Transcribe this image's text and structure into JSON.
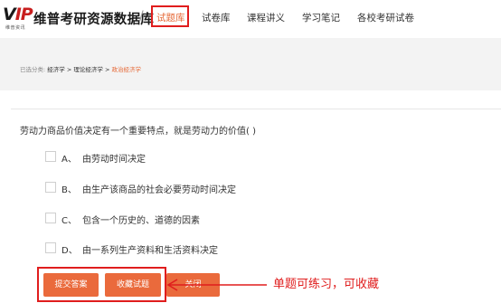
{
  "logo": {
    "mark_v": "V",
    "mark_ip": "IP",
    "subtitle": "维普资讯"
  },
  "brand": "维普考研资源数据库",
  "nav_separator": "/",
  "nav": [
    {
      "label": "试题库",
      "active": true
    },
    {
      "label": "试卷库"
    },
    {
      "label": "课程讲义"
    },
    {
      "label": "学习笔记"
    },
    {
      "label": "各校考研试卷"
    }
  ],
  "breadcrumb": {
    "prefix": "已选分类:",
    "path": [
      "经济学",
      "理论经济学"
    ],
    "current": "政治经济学",
    "separator": ">"
  },
  "question": {
    "text": "劳动力商品价值决定有一个重要特点，就是劳动力的价值( )",
    "options": [
      {
        "letter": "A、",
        "text": "由劳动时间决定",
        "checked": false
      },
      {
        "letter": "B、",
        "text": "由生产该商品的社会必要劳动时间决定",
        "checked": false
      },
      {
        "letter": "C、",
        "text": "包含一个历史的、道德的因素",
        "checked": false
      },
      {
        "letter": "D、",
        "text": "由一系列生产资料和生活资料决定",
        "checked": false
      }
    ]
  },
  "buttons": {
    "submit": "提交答案",
    "collect": "收藏试题",
    "third": "关闭"
  },
  "callout": "单题可练习，可收藏",
  "colors": {
    "accent": "#ea6a3c",
    "highlight": "#e01d1d",
    "band": "#f3f3f3"
  }
}
